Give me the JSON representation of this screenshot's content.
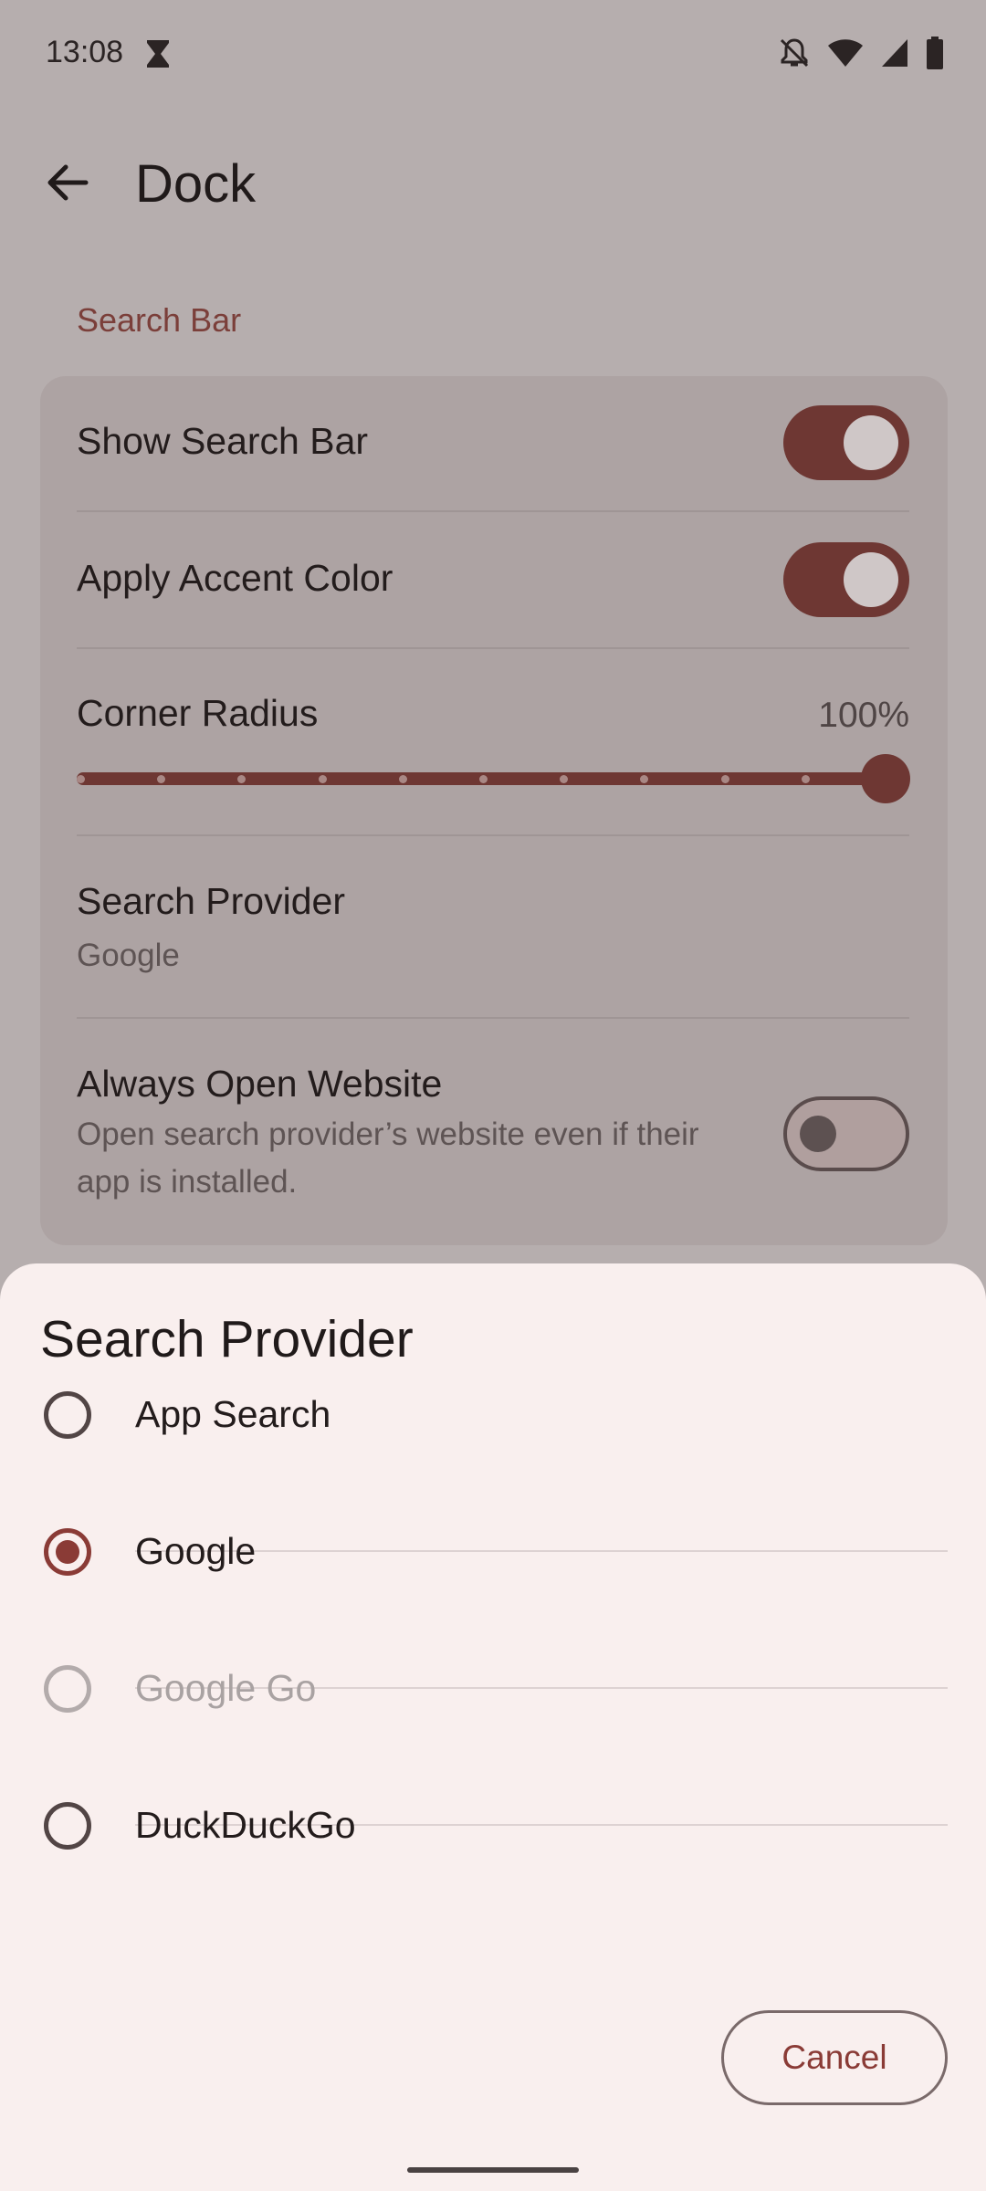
{
  "status_bar": {
    "time": "13:08",
    "icons": [
      "hourglass-icon",
      "notifications-off-icon",
      "wifi-icon",
      "signal-icon",
      "battery-icon"
    ]
  },
  "app_bar": {
    "title": "Dock",
    "back_icon": "arrow-left-icon"
  },
  "section": {
    "title": "Search Bar"
  },
  "settings": {
    "show_search_bar": {
      "label": "Show Search Bar",
      "enabled": true
    },
    "apply_accent_color": {
      "label": "Apply Accent Color",
      "enabled": true
    },
    "corner_radius": {
      "label": "Corner Radius",
      "value_text": "100%",
      "value": 100,
      "min": 0,
      "max": 100,
      "steps": 10
    },
    "search_provider": {
      "label": "Search Provider",
      "value": "Google"
    },
    "always_open_website": {
      "label": "Always Open Website",
      "description": "Open search provider’s website even if their app is installed.",
      "enabled": false
    }
  },
  "dialog": {
    "title": "Search Provider",
    "options": [
      {
        "label": "App Search",
        "selected": false,
        "disabled": false
      },
      {
        "label": "Google",
        "selected": true,
        "disabled": false
      },
      {
        "label": "Google Go",
        "selected": false,
        "disabled": true
      },
      {
        "label": "DuckDuckGo",
        "selected": false,
        "disabled": false
      }
    ],
    "cancel_label": "Cancel"
  },
  "colors": {
    "accent": "#8a3b36",
    "switch_on": "#6e3733",
    "sheet_bg": "#f9efee",
    "scrim_bg": "#b6aeae"
  }
}
